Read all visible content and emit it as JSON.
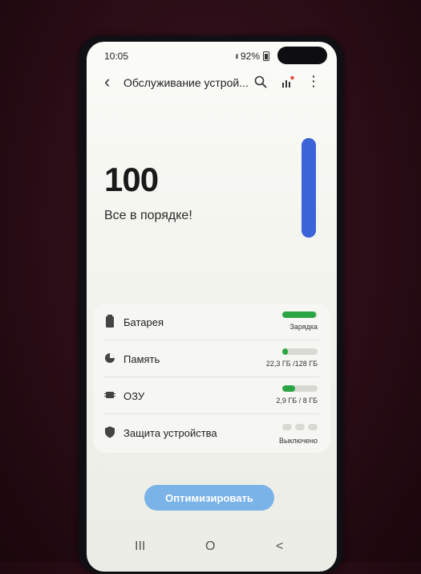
{
  "status_bar": {
    "time": "10:05",
    "signal": "ıll",
    "battery": "92%"
  },
  "toolbar": {
    "title": "Обслуживание устрой...",
    "back_icon": "‹",
    "search_icon": "search-icon",
    "stats_icon": "stats-icon",
    "more_icon": "⋮"
  },
  "summary": {
    "score": "100",
    "status": "Все в порядке!"
  },
  "items": [
    {
      "label": "Батарея",
      "value": "Зарядка",
      "fill": 0.95,
      "icon": "battery-icon"
    },
    {
      "label": "Память",
      "value": "22,3 ГБ /128 ГБ",
      "fill": 0.17,
      "icon": "storage-icon"
    },
    {
      "label": "ОЗУ",
      "value": "2,9 ГБ / 8 ГБ",
      "fill": 0.36,
      "icon": "ram-icon"
    },
    {
      "label": "Защита устройства",
      "value": "Выключено",
      "icon": "shield-icon"
    }
  ],
  "optimize_button": "Оптимизировать",
  "nav": {
    "recents": "III",
    "home": "O",
    "back": "<"
  },
  "colors": {
    "accent": "#3a64d8",
    "progress": "#2aa544",
    "button": "#7ab3e8"
  }
}
